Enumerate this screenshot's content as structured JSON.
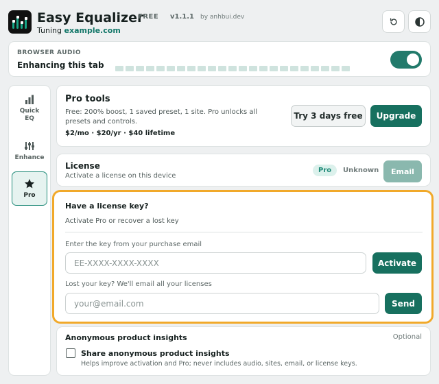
{
  "header": {
    "app_name": "Easy Equalizer",
    "plan_badge": "FREE",
    "version": "v1.1.1",
    "author": "by anhbui.dev",
    "tuning_prefix": "Tuning",
    "tuning_host": "example.com",
    "reset_icon": "reset-icon",
    "theme_icon": "contrast-icon"
  },
  "audio": {
    "kicker": "BROWSER AUDIO",
    "status": "Enhancing this tab",
    "enabled": true,
    "meter_segments": 23
  },
  "nav": {
    "items": [
      {
        "label": "Quick EQ",
        "icon": "bar-chart-icon",
        "active": false
      },
      {
        "label": "Enhance",
        "icon": "sliders-icon",
        "active": false
      },
      {
        "label": "Pro",
        "icon": "star-icon",
        "active": true
      }
    ]
  },
  "pro_tools": {
    "title": "Pro tools",
    "description": "Free: 200% boost, 1 saved preset, 1 site. Pro unlocks all presets and controls.",
    "pricing": "$2/mo · $20/yr · $40 lifetime",
    "trial_label": "Try 3 days free",
    "upgrade_label": "Upgrade"
  },
  "license": {
    "title": "License",
    "subtitle": "Activate a license on this device",
    "tier_badge": "Pro",
    "status": "Unknown",
    "email_label": "Email"
  },
  "license_key": {
    "title": "Have a license key?",
    "subtitle": "Activate Pro or recover a lost key",
    "key_label": "Enter the key from your purchase email",
    "key_placeholder": "EE-XXXX-XXXX-XXXX",
    "activate_label": "Activate",
    "lost_label": "Lost your key? We'll email all your licenses",
    "email_placeholder": "your@email.com",
    "send_label": "Send"
  },
  "insights": {
    "title": "Anonymous product insights",
    "optional": "Optional",
    "checkbox_label": "Share anonymous product insights",
    "checked": false,
    "help": "Helps improve activation and Pro; never includes audio, sites, email, or license keys."
  },
  "colors": {
    "accent": "#17705f",
    "highlight_border": "#f1a92a",
    "meter": "#cfe3de"
  }
}
